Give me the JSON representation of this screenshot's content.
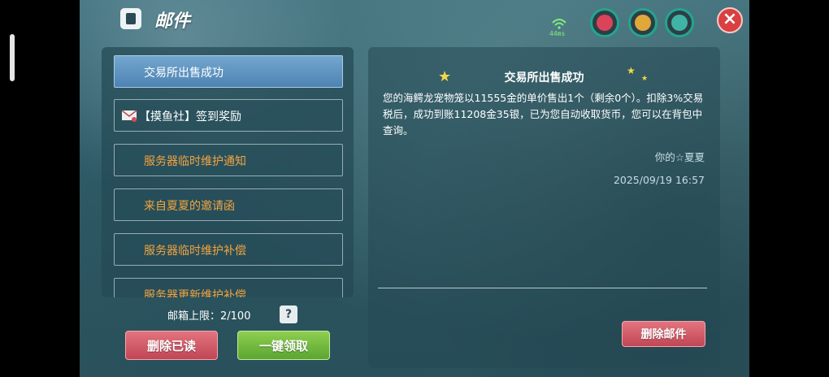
{
  "title": "邮件",
  "ping": "44ms",
  "mail_list": [
    {
      "label": "交易所出售成功",
      "state": "selected"
    },
    {
      "label": "【摸鱼社】签到奖励",
      "state": "read"
    },
    {
      "label": "服务器临时维护通知",
      "state": "unread"
    },
    {
      "label": "来自夏夏的邀请函",
      "state": "unread"
    },
    {
      "label": "服务器临时维护补偿",
      "state": "unread"
    },
    {
      "label": "服务器更新维护补偿",
      "state": "unread"
    }
  ],
  "mailbox_limit": "邮箱上限：2/100",
  "help_label": "?",
  "buttons": {
    "delete_read": "删除已读",
    "claim_all": "一键领取",
    "delete_mail": "删除邮件"
  },
  "detail": {
    "title": "交易所出售成功",
    "body": "您的海鳄龙宠物笼以11555金的单价售出1个（剩余0个）。扣除3%交易税后，成功到账11208金35银，已为您自动收取货币，您可以在背包中查询。",
    "sender": "你的☆夏夏",
    "date": "2025/09/19 16:57"
  },
  "colors": {
    "accent_orange": "#f3a440",
    "selected_blue": "#5f95c2",
    "button_red": "#d35c69",
    "button_green": "#74bb40"
  },
  "icons": [
    "mail-header-icon",
    "wifi-icon",
    "heart-icon",
    "arrow-icon",
    "droplet-icon",
    "close-icon",
    "envelope-icon",
    "star-icon"
  ]
}
